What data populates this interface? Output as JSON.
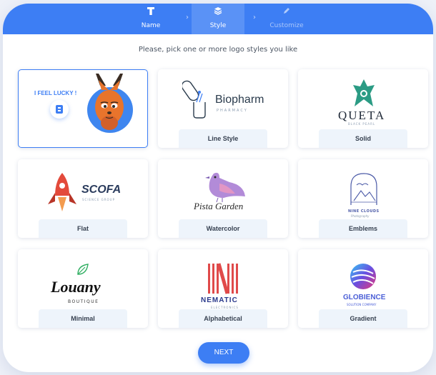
{
  "stepper": {
    "steps": [
      {
        "label": "Name",
        "icon": "text-icon"
      },
      {
        "label": "Style",
        "icon": "layers-icon"
      },
      {
        "label": "Customize",
        "icon": "pencil-icon"
      }
    ]
  },
  "instruction": "Please, pick one or more logo styles you like",
  "cards": [
    {
      "label": "",
      "logo": "I FEEL LUCKY !",
      "selected": true
    },
    {
      "label": "Line Style",
      "logo": "Biopharm",
      "sub": "PHARMACY"
    },
    {
      "label": "Solid",
      "logo": "QUETA",
      "sub": "BLACK PEARL"
    },
    {
      "label": "Flat",
      "logo": "SCOFA",
      "sub": "SCIENCE GROUP"
    },
    {
      "label": "Watercolor",
      "logo": "Pista Garden"
    },
    {
      "label": "Emblems",
      "logo": "NINE CLOUDS",
      "sub": "Photography"
    },
    {
      "label": "Minimal",
      "logo": "Louany",
      "sub": "BOUTIQUE"
    },
    {
      "label": "Alphabetical",
      "logo": "NEMATIC",
      "sub": "ELECTRONICS"
    },
    {
      "label": "Gradient",
      "logo": "GLOBIENCE",
      "sub": "SOLUTION COMPANY"
    }
  ],
  "next_label": "NEXT",
  "colors": {
    "accent": "#3d7ef4",
    "label_bg": "#eef4fb"
  }
}
